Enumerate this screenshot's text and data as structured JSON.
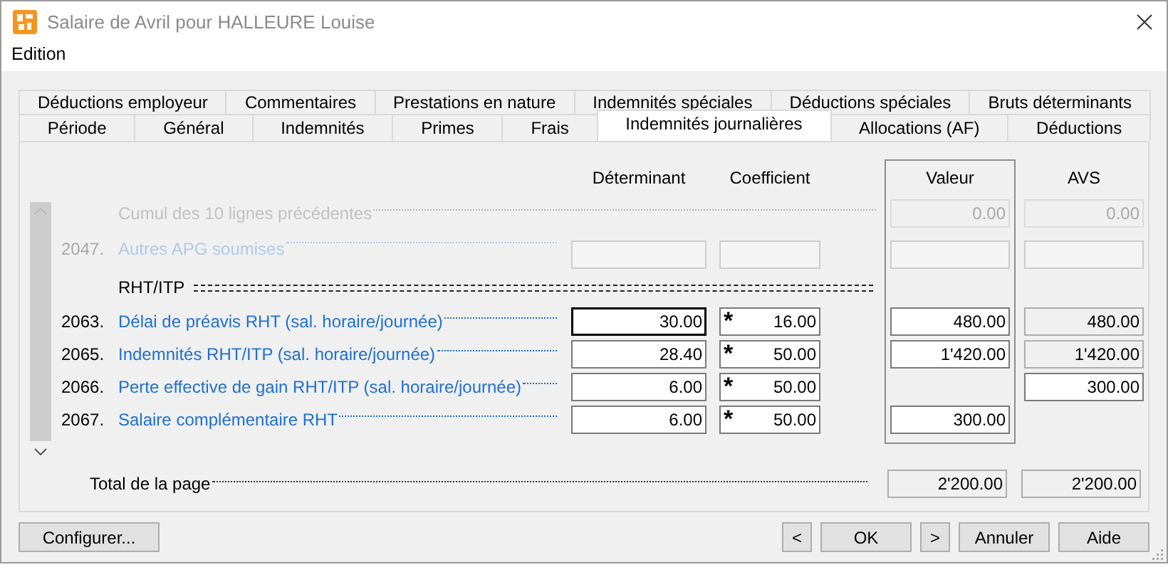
{
  "window": {
    "title": "Salaire de Avril pour HALLEURE Louise"
  },
  "menu": [
    "Edition"
  ],
  "tabs": {
    "back_row": [
      {
        "label": "Déductions employeur",
        "selected": false
      },
      {
        "label": "Commentaires",
        "selected": false
      },
      {
        "label": "Prestations en nature",
        "selected": false
      },
      {
        "label": "Indemnités spéciales",
        "selected": false
      },
      {
        "label": "Déductions spéciales",
        "selected": false
      },
      {
        "label": "Bruts déterminants",
        "selected": false
      }
    ],
    "front_row": [
      {
        "label": "Période",
        "selected": false
      },
      {
        "label": "Général",
        "selected": false
      },
      {
        "label": "Indemnités",
        "selected": false
      },
      {
        "label": "Primes",
        "selected": false
      },
      {
        "label": "Frais",
        "selected": false
      },
      {
        "label": "Indemnités journalières",
        "selected": true
      },
      {
        "label": "Allocations (AF)",
        "selected": false
      },
      {
        "label": "Déductions",
        "selected": false
      }
    ]
  },
  "columns": {
    "determinant": "Déterminant",
    "coefficient": "Coefficient",
    "valeur": "Valeur",
    "avs": "AVS"
  },
  "rows": [
    {
      "kind": "cumul",
      "label": "Cumul des 10 lignes précédentes",
      "faded": true,
      "valeur": {
        "value": "0.00",
        "readonly": true
      },
      "avs": {
        "value": "0.00",
        "readonly": true
      }
    },
    {
      "kind": "entry",
      "code": "2047.",
      "label": "Autres APG soumises",
      "faded": true,
      "determinant": {
        "focused": false
      },
      "coefficient": {
        "readonly": false
      },
      "valeur": {
        "readonly": false
      },
      "avs": {
        "readonly": false
      }
    },
    {
      "kind": "section",
      "label": "RHT/ITP"
    },
    {
      "kind": "entry",
      "code": "2063.",
      "label": "Délai de préavis RHT (sal. horaire/journée)",
      "faded": false,
      "determinant": {
        "value": "30.00",
        "focused": true
      },
      "coefficient": {
        "operator": "*",
        "value": "16.00"
      },
      "valeur": {
        "value": "480.00",
        "readonly": false
      },
      "avs": {
        "value": "480.00",
        "readonly": true
      }
    },
    {
      "kind": "entry",
      "code": "2065.",
      "label": "Indemnités RHT/ITP (sal. horaire/journée)",
      "faded": false,
      "determinant": {
        "value": "28.40",
        "focused": false
      },
      "coefficient": {
        "operator": "*",
        "value": "50.00"
      },
      "valeur": {
        "value": "1'420.00",
        "readonly": false
      },
      "avs": {
        "value": "1'420.00",
        "readonly": true
      }
    },
    {
      "kind": "entry",
      "code": "2066.",
      "label": "Perte effective de gain RHT/ITP (sal. horaire/journée)",
      "faded": false,
      "determinant": {
        "value": "6.00",
        "focused": false
      },
      "coefficient": {
        "operator": "*",
        "value": "50.00"
      },
      "avs": {
        "value": "300.00",
        "readonly": false
      }
    },
    {
      "kind": "entry",
      "code": "2067.",
      "label": "Salaire complémentaire RHT",
      "faded": false,
      "determinant": {
        "value": "6.00",
        "focused": false
      },
      "coefficient": {
        "operator": "*",
        "value": "50.00"
      },
      "valeur": {
        "value": "300.00",
        "readonly": false
      }
    }
  ],
  "total": {
    "label": "Total de la page",
    "valeur": "2'200.00",
    "avs": "2'200.00"
  },
  "left_buttons": [
    "Configurer..."
  ],
  "right_buttons": [
    "<",
    "OK",
    ">",
    "Annuler",
    "Aide"
  ]
}
